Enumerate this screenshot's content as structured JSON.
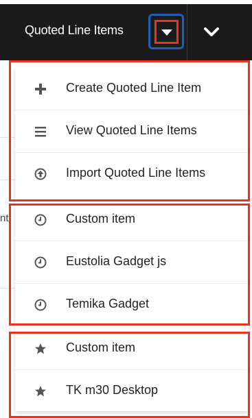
{
  "header": {
    "title": "Quoted Line Items",
    "caret_icon": "caret-down-icon",
    "chevron_icon": "chevron-down-icon"
  },
  "menu": {
    "actions": [
      {
        "label": "Create Quoted Line Item",
        "icon": "plus-icon"
      },
      {
        "label": "View Quoted Line Items",
        "icon": "list-icon"
      },
      {
        "label": "Import Quoted Line Items",
        "icon": "upload-circle-icon"
      }
    ],
    "recently_viewed": [
      {
        "label": "Custom item",
        "icon": "clock-icon"
      },
      {
        "label": "Eustolia Gadget js",
        "icon": "clock-icon"
      },
      {
        "label": "Temika Gadget",
        "icon": "clock-icon"
      }
    ],
    "favorites": [
      {
        "label": "Custom item",
        "icon": "star-icon"
      },
      {
        "label": "TK m30 Desktop",
        "icon": "star-icon"
      }
    ]
  },
  "background": {
    "left_fragment": "nt",
    "right_marks": [
      ":",
      ":"
    ]
  },
  "colors": {
    "navbar": "#1b1b1b",
    "highlight_red": "#e8331f",
    "highlight_blue": "#1f5fb6"
  }
}
